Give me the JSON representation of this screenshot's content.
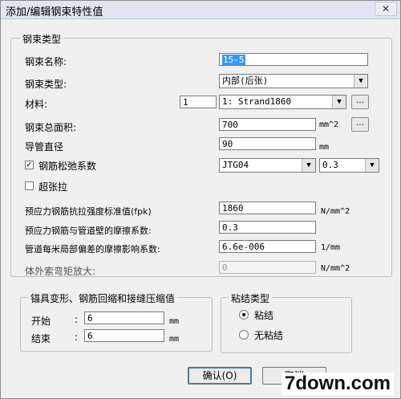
{
  "window": {
    "title": "添加/编辑钢束特性值",
    "close_glyph": "✕"
  },
  "group_main": {
    "legend": "钢束类型"
  },
  "fields": {
    "name": {
      "label": "钢束名称:",
      "value": "15-5"
    },
    "type": {
      "label": "钢束类型:",
      "value": "内部(后张)"
    },
    "material": {
      "label": "材料:",
      "number": "1",
      "value": "1: Strand1860",
      "more": "..."
    },
    "area": {
      "label": "钢束总面积:",
      "value": "700",
      "unit": "mm^2",
      "more": "..."
    },
    "duct": {
      "label": "导管直径",
      "value": "90",
      "unit": "mm"
    },
    "relax": {
      "label": "钢筋松弛系数",
      "checked": true,
      "check_glyph": "✓",
      "code": "JTG04",
      "coef": "0.3"
    },
    "overtension": {
      "label": "超张拉",
      "checked": false
    },
    "fpk": {
      "label": "预应力钢筋抗拉强度标准值(fpk)",
      "value": "1860",
      "unit": "N/mm^2"
    },
    "friction": {
      "label": "预应力钢筋与管道壁的摩擦系数:",
      "value": "0.3"
    },
    "wobble": {
      "label": "管道每米局部偏差的摩擦影响系数:",
      "value": "6.6e-006",
      "unit": "1/mm"
    },
    "external": {
      "label": "体外索弯矩放大:",
      "value": "0",
      "unit": "N/mm^2"
    }
  },
  "anchor": {
    "legend": "锚具变形、钢筋回缩和接缝压缩值",
    "start": {
      "label": "开始",
      "colon": ":",
      "value": "6",
      "unit": "mm"
    },
    "end": {
      "label": "结束",
      "colon": ":",
      "value": "6",
      "unit": "mm"
    }
  },
  "bond": {
    "legend": "粘结类型",
    "options": [
      {
        "label": "粘结",
        "selected": true
      },
      {
        "label": "无粘结",
        "selected": false
      }
    ]
  },
  "buttons": {
    "ok": "确认(O)",
    "cancel": "取消"
  },
  "watermark": "7down.com",
  "arrow_glyph": "▼"
}
